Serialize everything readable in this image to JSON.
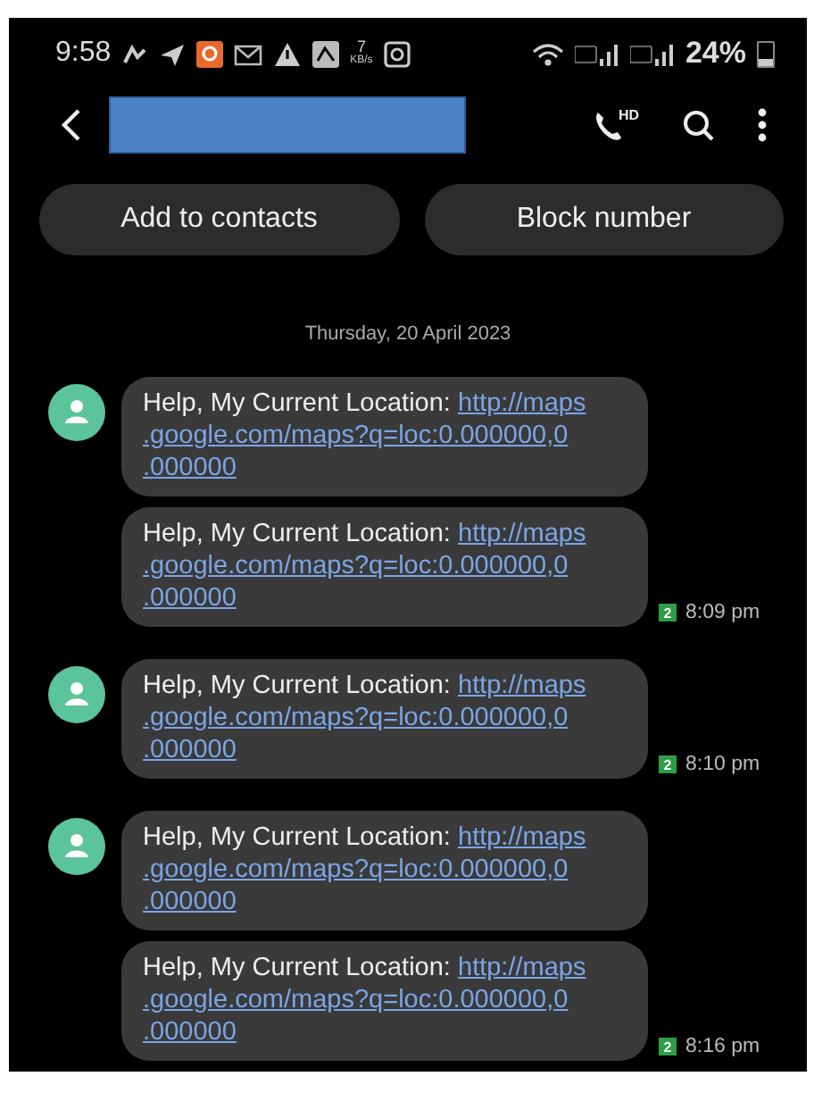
{
  "status_bar": {
    "time": "9:58",
    "net_speed": "7",
    "net_unit": "KB/s",
    "battery": "24%"
  },
  "header": {
    "name_redacted": true,
    "call_badge": "HD"
  },
  "actions": [
    "Add to contacts",
    "Block number"
  ],
  "date": "Thursday, 20 April 2023",
  "groups": [
    {
      "messages": [
        {
          "text": "Help, My Current Location: ",
          "link_lines": [
            "http://maps",
            ".google.com/maps?q=loc:0.000000,0",
            ".000000"
          ]
        },
        {
          "text": "Help, My Current Location: ",
          "link_lines": [
            "http://maps",
            ".google.com/maps?q=loc:0.000000,0",
            ".000000"
          ]
        }
      ],
      "sim": "2",
      "time": "8:09 pm"
    },
    {
      "messages": [
        {
          "text": "Help, My Current Location: ",
          "link_lines": [
            "http://maps",
            ".google.com/maps?q=loc:0.000000,0",
            ".000000"
          ]
        }
      ],
      "sim": "2",
      "time": "8:10 pm"
    },
    {
      "messages": [
        {
          "text": "Help, My Current Location: ",
          "link_lines": [
            "http://maps",
            ".google.com/maps?q=loc:0.000000,0",
            ".000000"
          ]
        },
        {
          "text": "Help, My Current Location: ",
          "link_lines": [
            "http://maps",
            ".google.com/maps?q=loc:0.000000,0",
            ".000000"
          ]
        }
      ],
      "sim": "2",
      "time": "8:16 pm"
    }
  ]
}
